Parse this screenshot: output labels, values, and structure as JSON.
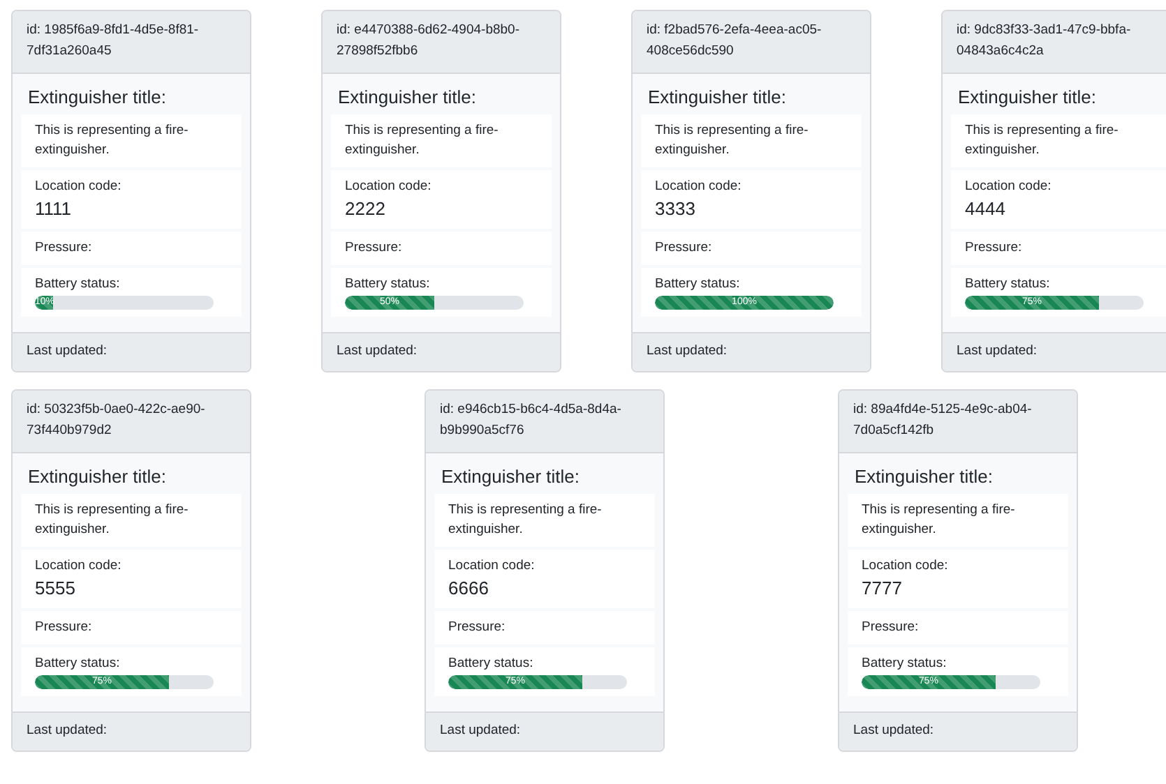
{
  "rows": [
    {
      "cards": [
        {
          "id": "id: 1985f6a9-8fd1-4d5e-8f81-7df31a260a45",
          "title": "Extinguisher title:",
          "description": "This is representing a fire-extinguisher.",
          "location_label": "Location code:",
          "location_code": "1111",
          "pressure_label": "Pressure:",
          "battery_label": "Battery status:",
          "battery": {
            "level": 0.1,
            "reading": "10%"
          },
          "footer": "Last updated:"
        },
        {
          "id": "id: e4470388-6d62-4904-b8b0-27898f52fbb6",
          "title": "Extinguisher title:",
          "description": "This is representing a fire-extinguisher.",
          "location_label": "Location code:",
          "location_code": "2222",
          "pressure_label": "Pressure:",
          "battery_label": "Battery status:",
          "battery": {
            "level": 0.5,
            "reading": "50%"
          },
          "footer": "Last updated:"
        },
        {
          "id": "id: f2bad576-2efa-4eea-ac05-408ce56dc590",
          "title": "Extinguisher title:",
          "description": "This is representing a fire-extinguisher.",
          "location_label": "Location code:",
          "location_code": "3333",
          "pressure_label": "Pressure:",
          "battery_label": "Battery status:",
          "battery": {
            "level": 1,
            "reading": "100%"
          },
          "footer": "Last updated:"
        },
        {
          "id": "id: 9dc83f33-3ad1-47c9-bbfa-04843a6c4c2a",
          "title": "Extinguisher title:",
          "description": "This is representing a fire-extinguisher.",
          "location_label": "Location code:",
          "location_code": "4444",
          "pressure_label": "Pressure:",
          "battery_label": "Battery status:",
          "battery": {
            "level": 0.75,
            "reading": "75%"
          },
          "footer": "Last updated:"
        }
      ]
    },
    {
      "cards": [
        {
          "id": "id: 50323f5b-0ae0-422c-ae90-73f440b979d2",
          "title": "Extinguisher title:",
          "description": "This is representing a fire-extinguisher.",
          "location_label": "Location code:",
          "location_code": "5555",
          "pressure_label": "Pressure:",
          "battery_label": "Battery status:",
          "battery": {
            "level": 0.75,
            "reading": "75%"
          },
          "footer": "Last updated:"
        },
        {
          "id": "id: e946cb15-b6c4-4d5a-8d4a-b9b990a5cf76",
          "title": "Extinguisher title:",
          "description": "This is representing a fire-extinguisher.",
          "location_label": "Location code:",
          "location_code": "6666",
          "pressure_label": "Pressure:",
          "battery_label": "Battery status:",
          "battery": {
            "level": 0.75,
            "reading": "75%"
          },
          "footer": "Last updated:"
        },
        {
          "id": "id: 89a4fd4e-5125-4e9c-ab04-7d0a5cf142fb",
          "title": "Extinguisher title:",
          "description": "This is representing a fire-extinguisher.",
          "location_label": "Location code:",
          "location_code": "7777",
          "pressure_label": "Pressure:",
          "battery_label": "Battery status:",
          "battery": {
            "level": 0.75,
            "reading": "75%"
          },
          "footer": "Last updated:"
        }
      ]
    }
  ]
}
